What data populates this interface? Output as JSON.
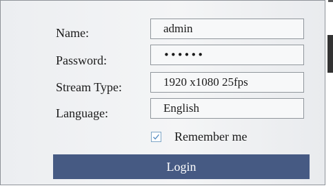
{
  "form": {
    "name_label": "Name:",
    "name_value": "admin",
    "password_label": "Password:",
    "password_value": "••••••",
    "stream_type_label": "Stream Type:",
    "stream_type_value": "1920 x1080 25fps",
    "language_label": "Language:",
    "language_value": "English",
    "remember_label": "Remember me",
    "remember_checked": true,
    "login_label": "Login"
  },
  "colors": {
    "login_button_bg": "#465a83",
    "login_button_text": "#ffffff",
    "checkbox_check": "#5b8fc3"
  },
  "icons": {
    "remember": "checkmark-icon"
  }
}
